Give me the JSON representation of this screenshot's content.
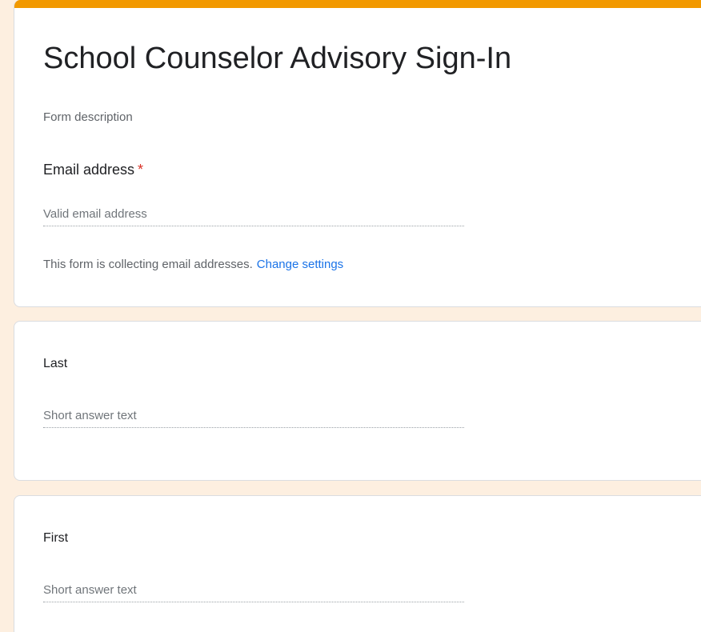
{
  "form": {
    "title": "School Counselor Advisory Sign-In",
    "description_placeholder": "Form description",
    "accent_color": "#f29900",
    "background_color": "#fdefe0"
  },
  "email_question": {
    "label": "Email address",
    "required_marker": "*",
    "placeholder": "Valid email address",
    "notice_text": "This form is collecting email addresses.",
    "notice_link": "Change settings"
  },
  "questions": [
    {
      "label": "Last",
      "placeholder": "Short answer text"
    },
    {
      "label": "First",
      "placeholder": "Short answer text"
    }
  ]
}
